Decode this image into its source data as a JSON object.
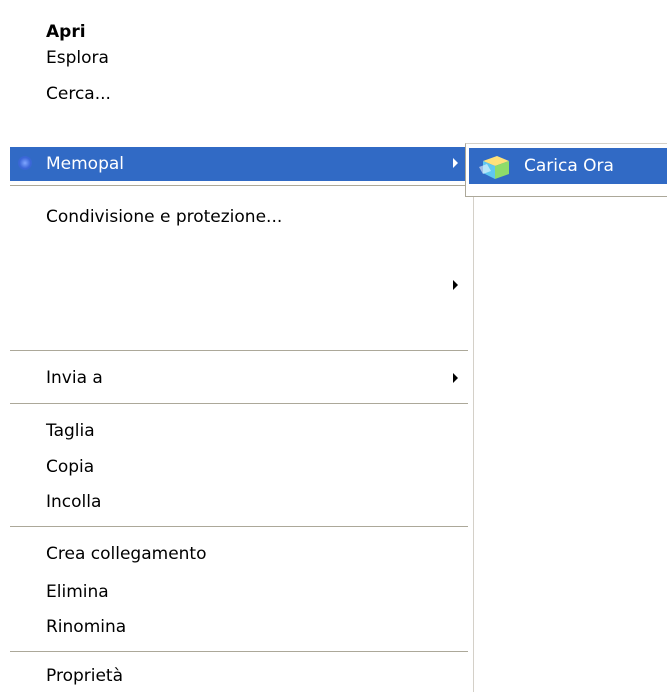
{
  "menu": {
    "open": "Apri",
    "explore": "Esplora",
    "search": "Cerca...",
    "memopal": "Memopal",
    "sharing": "Condivisione e protezione...",
    "blank_submenu": "",
    "send_to": "Invia a",
    "cut": "Taglia",
    "copy": "Copia",
    "paste": "Incolla",
    "create_shortcut": "Crea collegamento",
    "delete": "Elimina",
    "rename": "Rinomina",
    "properties": "Proprietà"
  },
  "submenu": {
    "upload_now": "Carica Ora"
  },
  "icons": {
    "memopal": "memopal-icon",
    "upload": "cube-upload-icon"
  },
  "colors": {
    "highlight": "#316ac5",
    "separator": "#aca899"
  }
}
